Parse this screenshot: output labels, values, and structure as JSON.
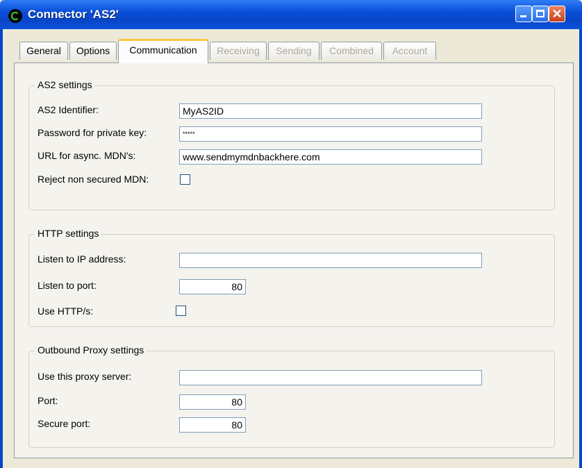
{
  "window": {
    "title": "Connector 'AS2'"
  },
  "tabs": [
    {
      "label": "General",
      "state": "normal"
    },
    {
      "label": "Options",
      "state": "normal"
    },
    {
      "label": "Communication",
      "state": "active"
    },
    {
      "label": "Receiving",
      "state": "disabled"
    },
    {
      "label": "Sending",
      "state": "disabled"
    },
    {
      "label": "Combined",
      "state": "disabled"
    },
    {
      "label": "Account",
      "state": "disabled"
    }
  ],
  "as2": {
    "legend": "AS2 settings",
    "identifier_label": "AS2 Identifier:",
    "identifier_value": "MyAS2ID",
    "password_label": "Password for private key:",
    "password_value": "*****",
    "url_label": "URL for async. MDN's:",
    "url_value": "www.sendmymdnbackhere.com",
    "reject_label": "Reject non secured MDN:",
    "reject_checked": false
  },
  "http": {
    "legend": "HTTP settings",
    "ip_label": "Listen to IP address:",
    "ip_value": "",
    "port_label": "Listen to port:",
    "port_value": "80",
    "https_label": "Use HTTP/s:",
    "https_checked": false
  },
  "proxy": {
    "legend": "Outbound Proxy settings",
    "server_label": "Use this proxy server:",
    "server_value": "",
    "port_label": "Port:",
    "port_value": "80",
    "secure_port_label": "Secure port:",
    "secure_port_value": "80"
  },
  "colors": {
    "titlebar": "#0a4fd8",
    "active_tab_accent": "#ffc83c",
    "dialog_bg": "#ece9d8"
  },
  "icons": [
    "app-icon",
    "minimize-icon",
    "maximize-icon",
    "close-icon"
  ]
}
